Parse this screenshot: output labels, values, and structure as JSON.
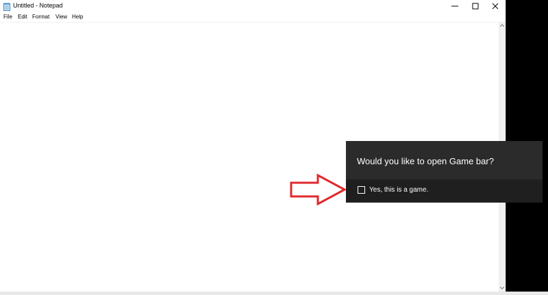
{
  "window": {
    "title": "Untitled - Notepad"
  },
  "menu": {
    "items": [
      {
        "label": "File"
      },
      {
        "label": "Edit"
      },
      {
        "label": "Format"
      },
      {
        "label": "View"
      },
      {
        "label": "Help"
      }
    ]
  },
  "gamebar": {
    "question": "Would you like to open Game bar?",
    "checkbox_label": "Yes, this is a game.",
    "checked": false
  },
  "colors": {
    "gamebar_bg": "#2b2b2b",
    "gamebar_bottom_bg": "#1f1f1f",
    "arrow": "#e0282c"
  },
  "icons": {
    "app": "notepad-icon",
    "minimize": "minimize-icon",
    "maximize": "maximize-icon",
    "close": "close-icon",
    "arrow": "red-outline-arrow-icon"
  }
}
